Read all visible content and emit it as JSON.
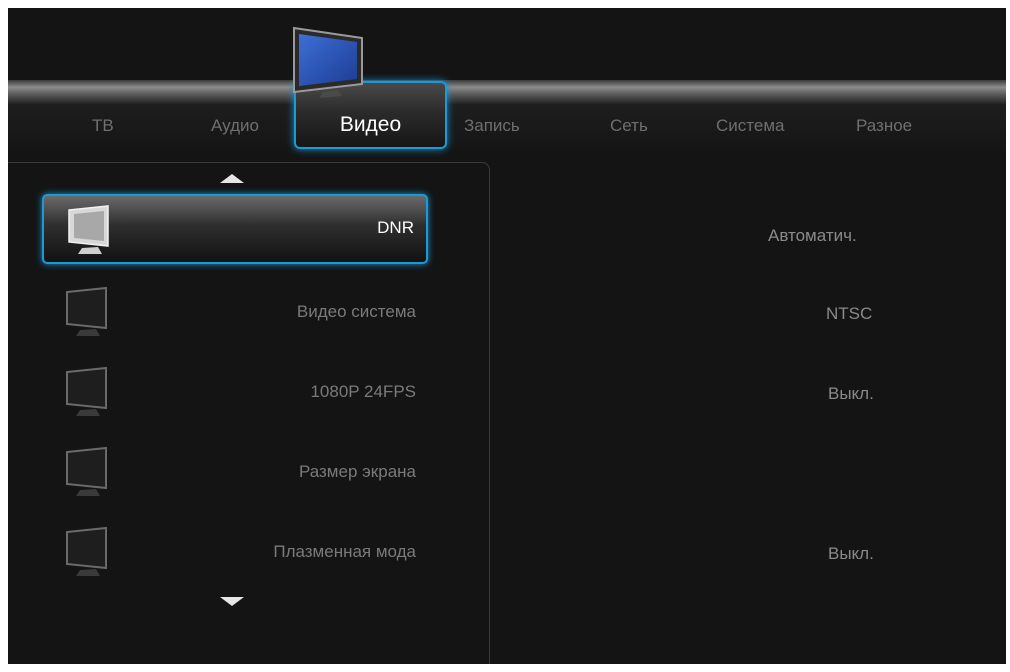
{
  "menu": {
    "tabs": [
      {
        "label": "ТВ"
      },
      {
        "label": "Аудио"
      },
      {
        "label": "Видео"
      },
      {
        "label": "Запись"
      },
      {
        "label": "Сеть"
      },
      {
        "label": "Система"
      },
      {
        "label": "Разное"
      }
    ],
    "active_tab": "Видео"
  },
  "settings": {
    "items": [
      {
        "label": "DNR",
        "value": "Автоматич.",
        "selected": true
      },
      {
        "label": "Видео система",
        "value": "NTSC"
      },
      {
        "label": "1080P 24FPS",
        "value": "Выкл."
      },
      {
        "label": "Размер экрана",
        "value": ""
      },
      {
        "label": "Плазменная мода",
        "value": "Выкл."
      }
    ]
  },
  "icons": {
    "tab_icon": "tv-icon",
    "row_icon": "monitor-icon",
    "scroll_up": "arrow-up-icon",
    "scroll_down": "arrow-down-icon"
  },
  "colors": {
    "background": "#141414",
    "accent": "#1c9ad6",
    "text_active": "#ffffff",
    "text_inactive": "#7a7a7a"
  }
}
